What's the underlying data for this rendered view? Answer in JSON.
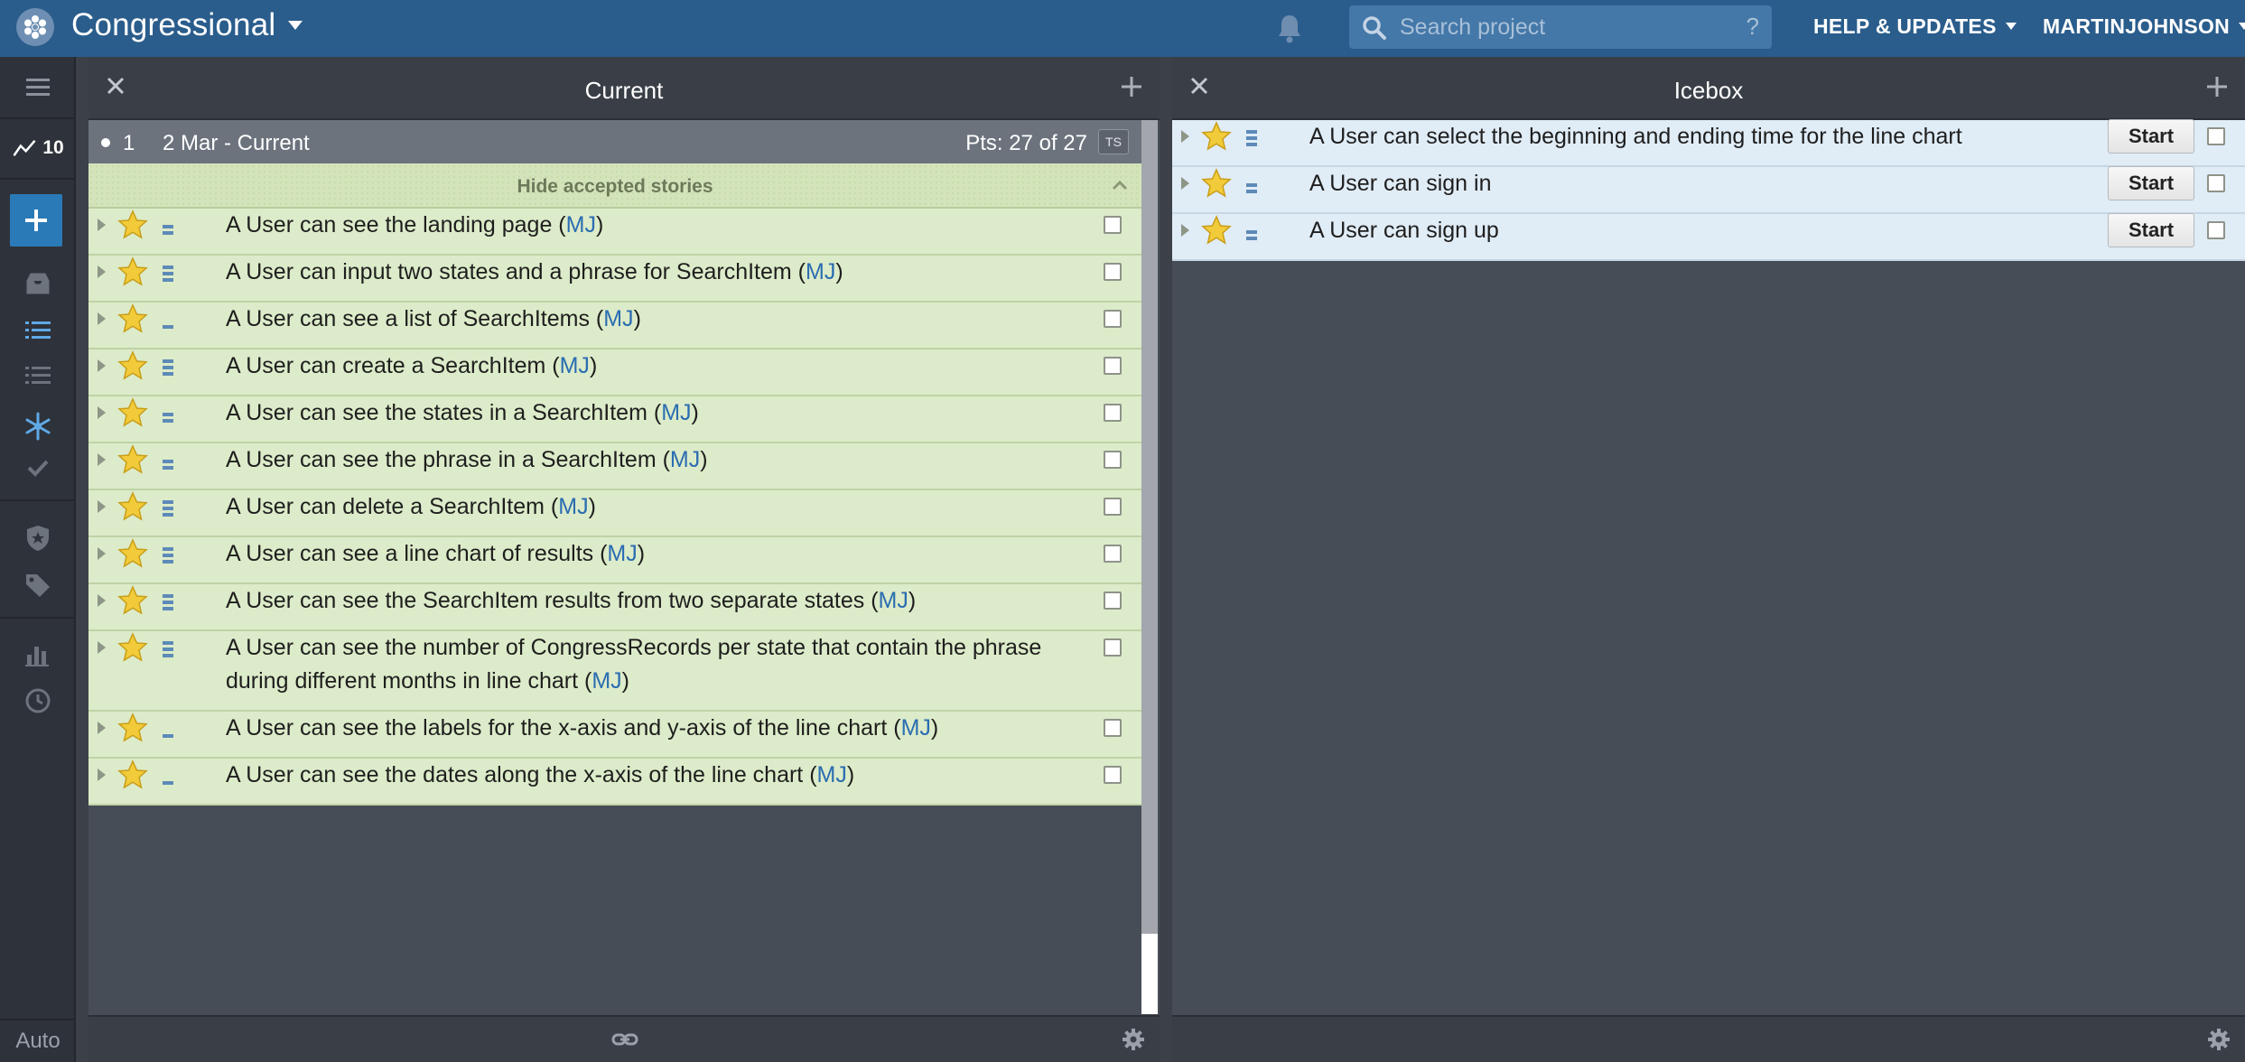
{
  "app": {
    "project_name": "Congressional",
    "search_placeholder": "Search project",
    "search_help": "?",
    "help_menu": "HELP & UPDATES",
    "user_menu": "MARTINJOHNSON",
    "accent_color": "#2a5d8c"
  },
  "sidebar": {
    "velocity": "10",
    "mode": "Auto",
    "icons": [
      "menu-icon",
      "velocity-icon",
      "add-story-icon",
      "my-work-icon",
      "current-backlog-icon",
      "backlog-icon",
      "icebox-icon",
      "done-icon",
      "epics-icon",
      "labels-icon",
      "reports-icon",
      "history-icon"
    ]
  },
  "current": {
    "title": "Current",
    "iteration": {
      "number": "1",
      "dates": "2 Mar - Current",
      "points": "Pts: 27 of 27",
      "team_strength": "TS"
    },
    "hide_label": "Hide accepted stories",
    "stories": [
      {
        "text": "A User can see the landing page (",
        "owner": "MJ",
        "close": ")",
        "points": 2
      },
      {
        "text": "A User can input two states and a phrase for SearchItem (",
        "owner": "MJ",
        "close": ")",
        "points": 3
      },
      {
        "text": "A User can see a list of SearchItems (",
        "owner": "MJ",
        "close": ")",
        "points": 1
      },
      {
        "text": "A User can create a SearchItem (",
        "owner": "MJ",
        "close": ")",
        "points": 3
      },
      {
        "text": "A User can see the states in a SearchItem (",
        "owner": "MJ",
        "close": ")",
        "points": 2
      },
      {
        "text": "A User can see the phrase in a SearchItem (",
        "owner": "MJ",
        "close": ")",
        "points": 2
      },
      {
        "text": "A User can delete a SearchItem (",
        "owner": "MJ",
        "close": ")",
        "points": 3
      },
      {
        "text": "A User can see a line chart of results (",
        "owner": "MJ",
        "close": ")",
        "points": 3
      },
      {
        "text": "A User can see the SearchItem results from two separate states (",
        "owner": "MJ",
        "close": ")",
        "points": 3
      },
      {
        "text": "A User can see the number of CongressRecords per state that contain the phrase during different months in line chart (",
        "owner": "MJ",
        "close": ")",
        "points": 3
      },
      {
        "text": "A User can see the labels for the x-axis and y-axis of the line chart (",
        "owner": "MJ",
        "close": ")",
        "points": 1
      },
      {
        "text": "A User can see the dates along the x-axis of the line chart (",
        "owner": "MJ",
        "close": ")",
        "points": 1
      }
    ]
  },
  "icebox": {
    "title": "Icebox",
    "start_label": "Start",
    "stories": [
      {
        "text": "A User can select the beginning and ending time for the line chart",
        "points": 3
      },
      {
        "text": "A User can sign in",
        "points": 2
      },
      {
        "text": "A User can sign up",
        "points": 2
      }
    ]
  }
}
